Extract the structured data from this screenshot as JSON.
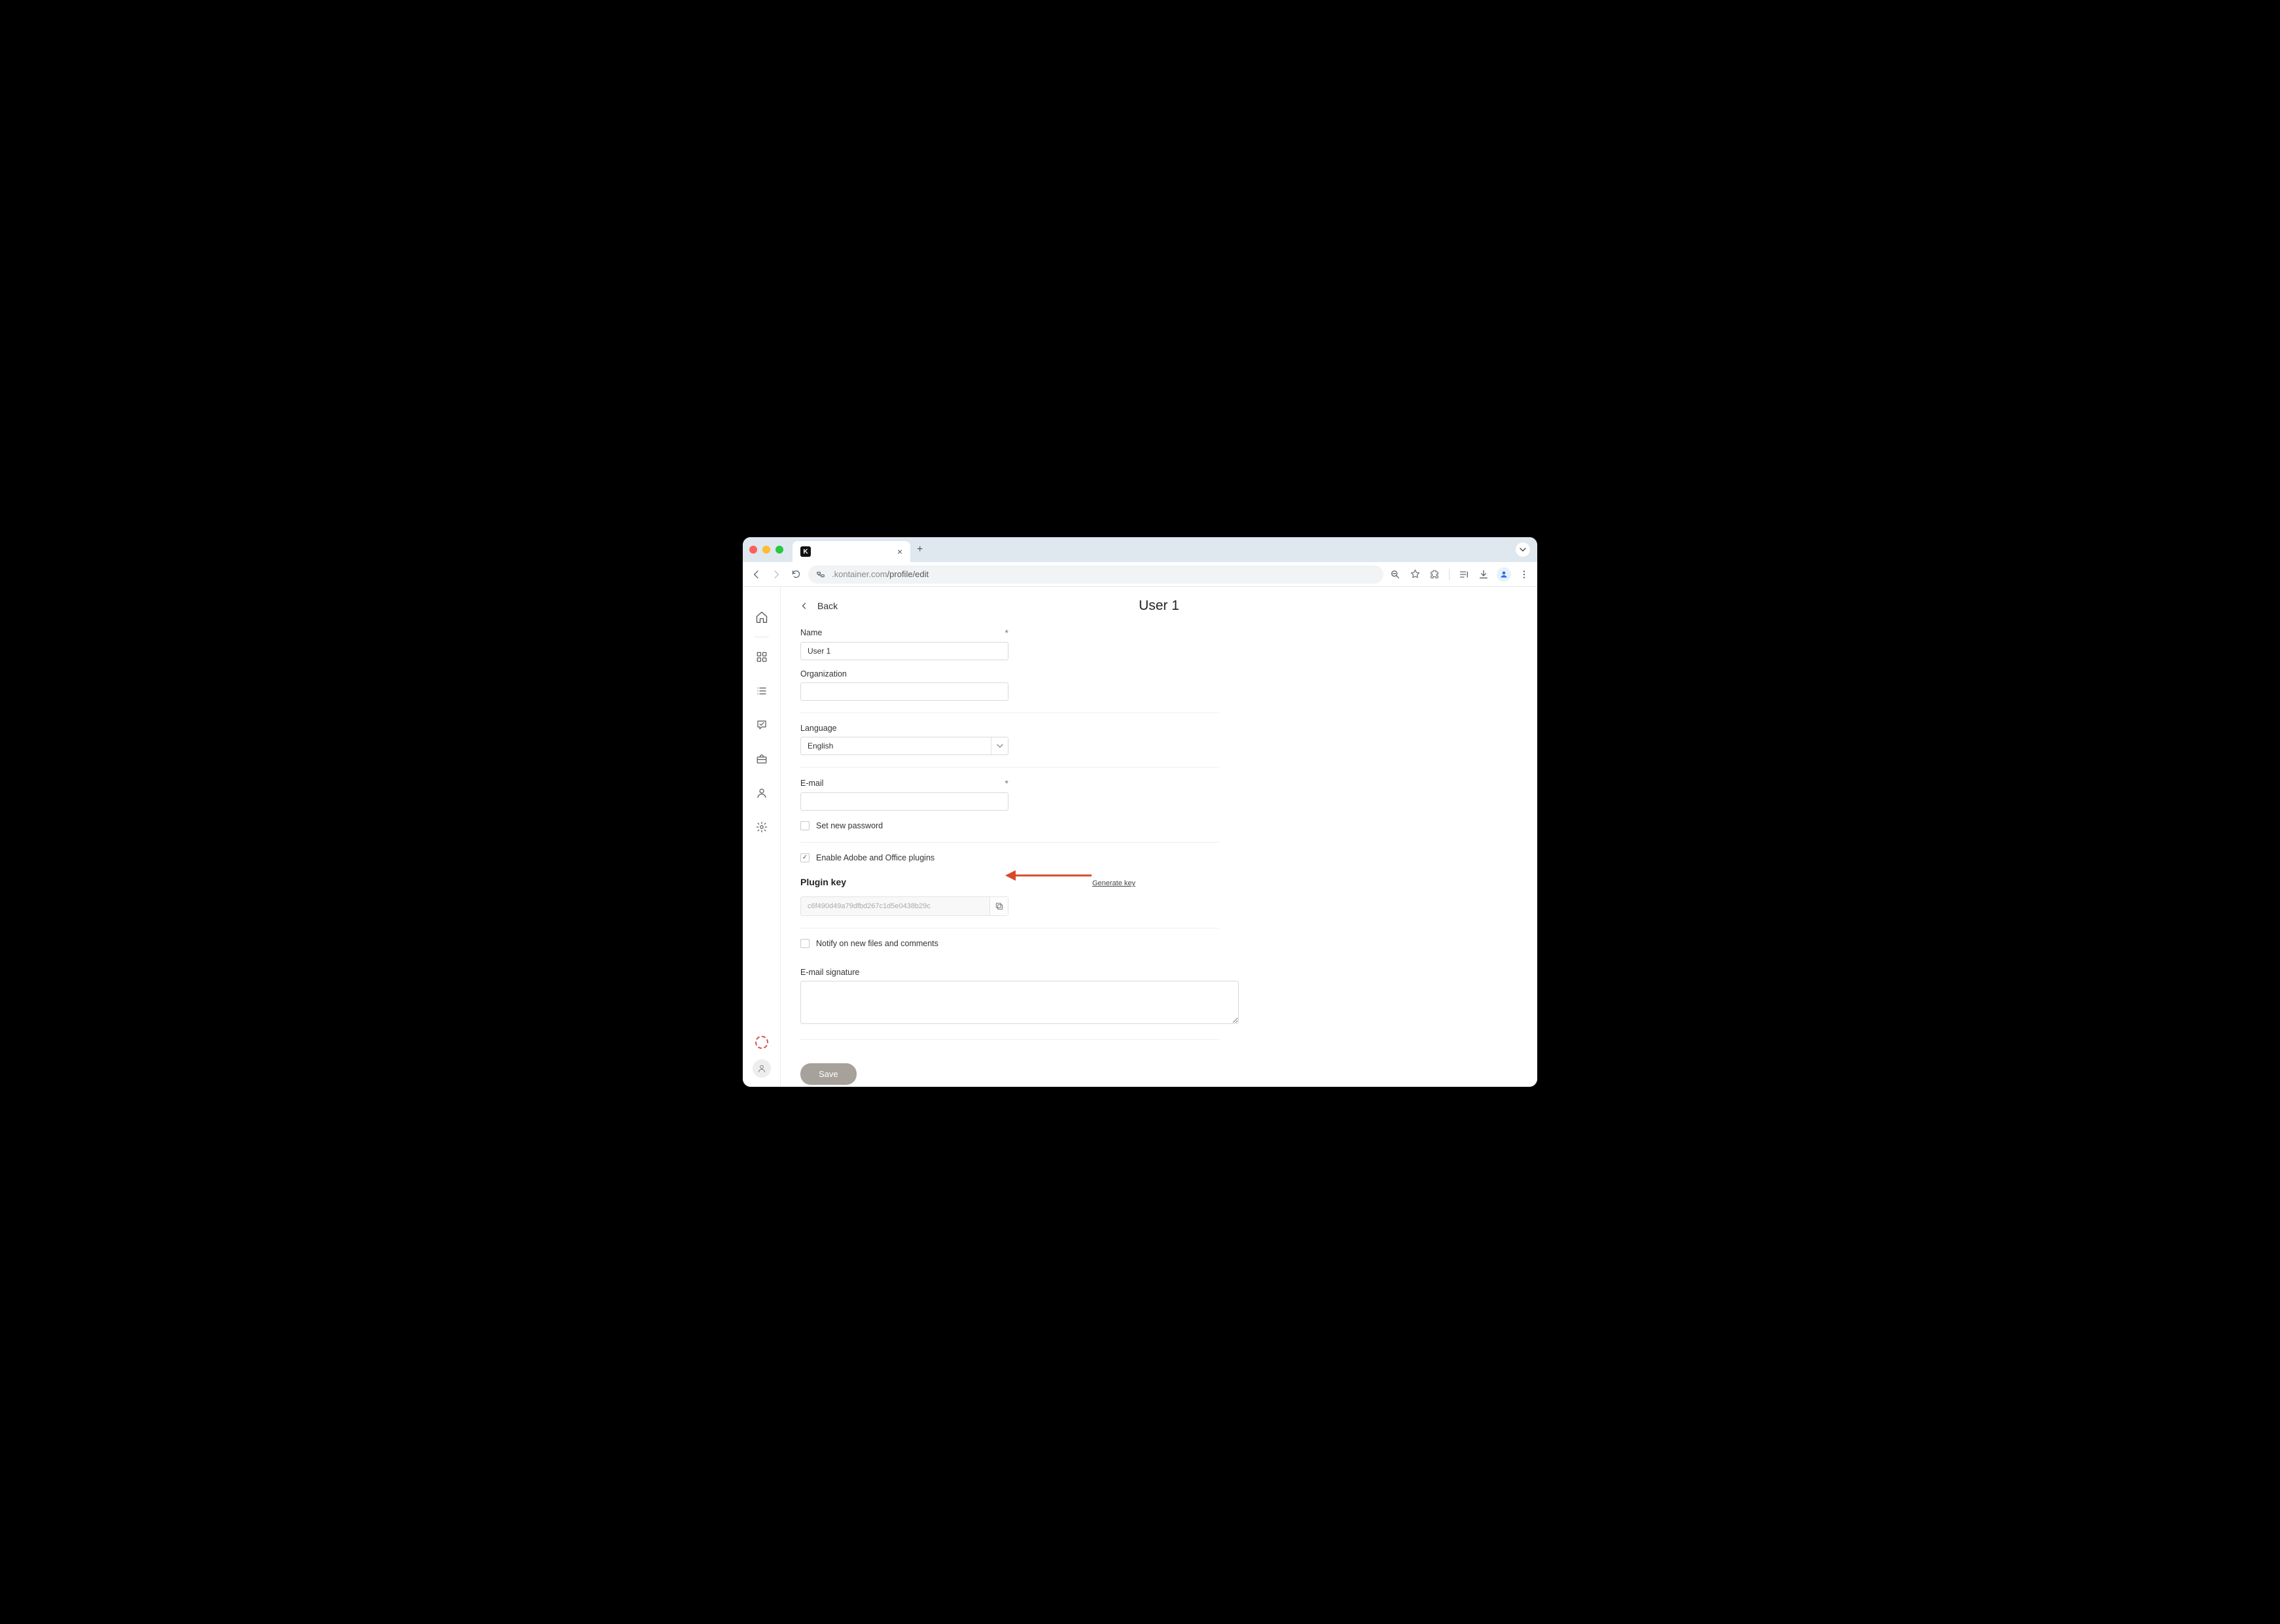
{
  "browser": {
    "tab_title": "",
    "url_display_host": ".kontainer.com",
    "url_display_path": "/profile/edit"
  },
  "header": {
    "back_label": "Back",
    "page_title": "User 1"
  },
  "form": {
    "name": {
      "label": "Name",
      "required": true,
      "value": "User 1"
    },
    "organization": {
      "label": "Organization",
      "value": ""
    },
    "language": {
      "label": "Language",
      "value": "English"
    },
    "email": {
      "label": "E-mail",
      "required": true,
      "value": ""
    },
    "set_password": {
      "label": "Set new password",
      "checked": false
    },
    "enable_plugins": {
      "label": "Enable Adobe and Office plugins",
      "checked": true
    },
    "plugin_key": {
      "title": "Plugin key",
      "generate_label": "Generate key",
      "value": "c6f490d49a79dfbd267c1d5e0438b29c"
    },
    "notify": {
      "label": "Notify on new files and comments",
      "checked": false
    },
    "signature": {
      "label": "E-mail signature",
      "value": ""
    },
    "save_label": "Save"
  },
  "icons": {
    "favicon_text": "K"
  },
  "annotation": {
    "arrow_color": "#d9482b"
  }
}
